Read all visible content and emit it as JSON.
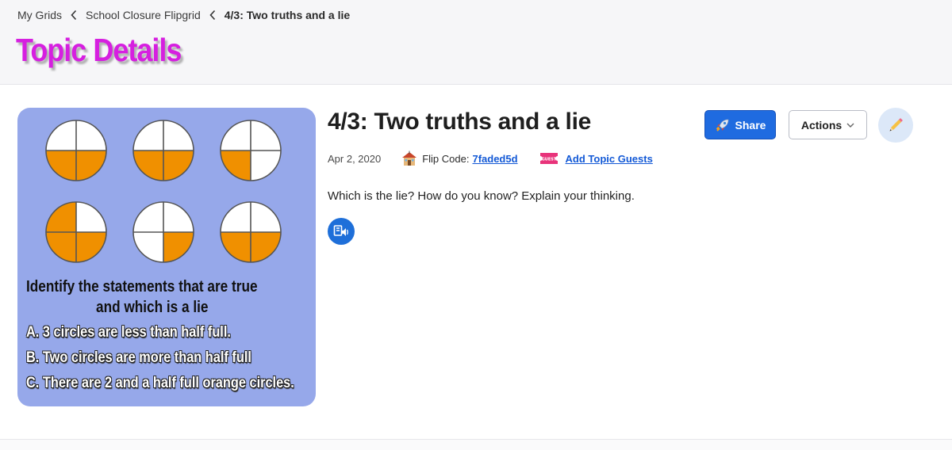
{
  "breadcrumb": {
    "items": [
      "My Grids",
      "School Closure Flipgrid",
      "4/3: Two truths and a lie"
    ]
  },
  "header": {
    "title": "Topic Details"
  },
  "topic": {
    "title": "4/3: Two truths and a lie",
    "date": "Apr 2, 2020",
    "flip_code_label": "Flip Code:",
    "flip_code": "7faded5d",
    "guests_label": "Add Topic Guests",
    "guest_badge": "GUEST",
    "prompt": "Which is the lie? How do you know? Explain your thinking."
  },
  "toolbar": {
    "share_label": "Share",
    "actions_label": "Actions"
  },
  "thumbnail": {
    "heading_line1": "Identify the statements that are true",
    "heading_line2": "and which is a lie",
    "statements": [
      "A. 3 circles are less than half full.",
      "B. Two circles are more than half full",
      "C. There are 2 and a half full orange circles."
    ],
    "pie_orange_quarters": [
      [
        "bottom-left",
        "bottom-right"
      ],
      [
        "bottom-left",
        "bottom-right"
      ],
      [
        "bottom-left"
      ],
      [
        "top-left",
        "bottom-left",
        "bottom-right"
      ],
      [
        "bottom-right"
      ],
      [
        "bottom-left",
        "bottom-right"
      ]
    ]
  },
  "colors": {
    "title_magenta": "#d61fe0",
    "link_blue": "#1359d6",
    "share_blue": "#1f6be0",
    "thumb_bg": "#96a8ea",
    "pie_orange": "#f09000"
  },
  "icons": {
    "breadcrumb_separator": "chevron-left-icon",
    "school": "school-house-icon",
    "guest": "guest-ticket-icon",
    "audio": "immersive-reader-icon",
    "share": "rocket-icon",
    "actions": "chevron-down-icon",
    "edit": "pencil-icon"
  }
}
